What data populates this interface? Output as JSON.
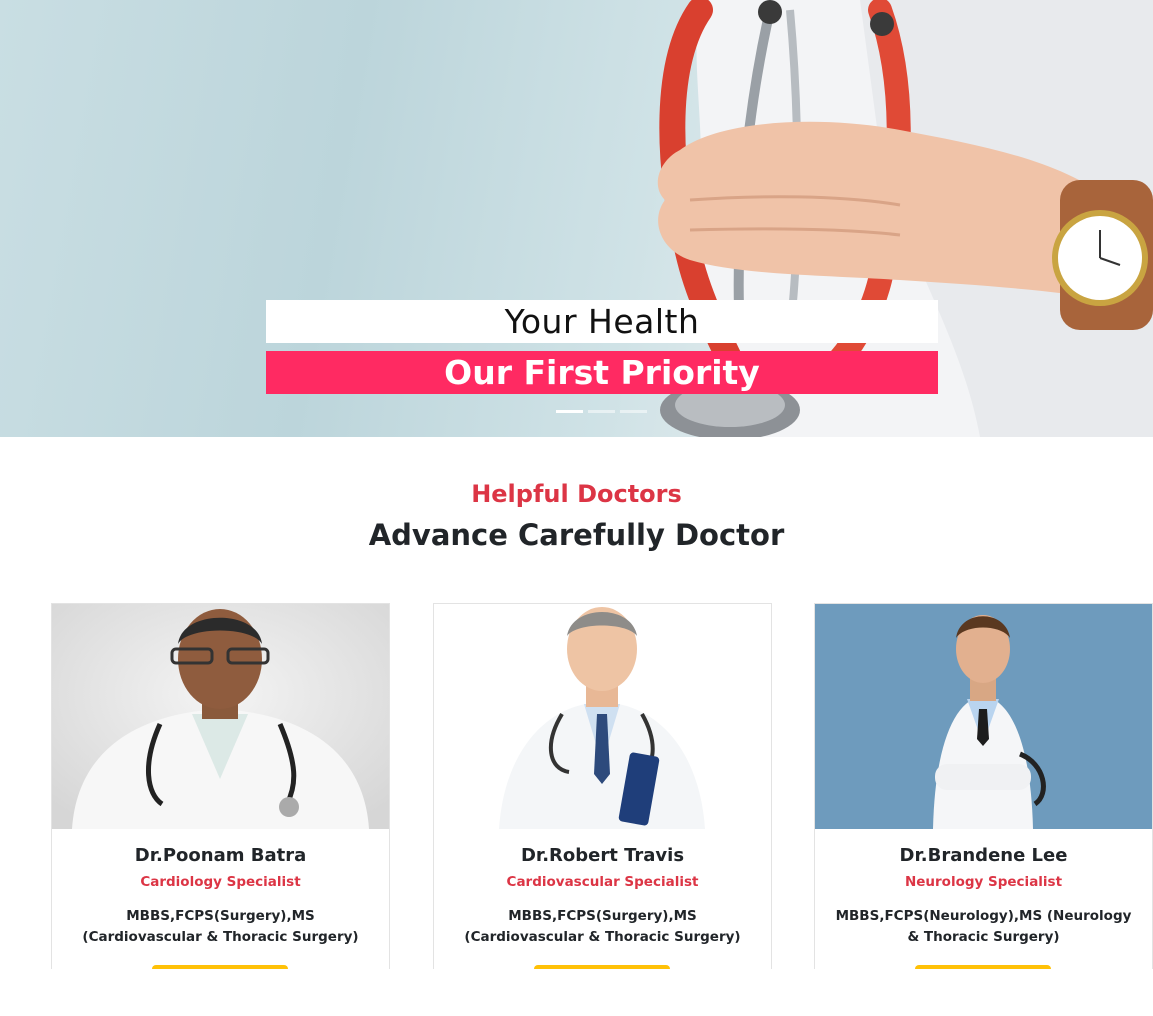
{
  "hero": {
    "title": "Your Health",
    "subtitle": "Our First Priority",
    "slides": 3,
    "active_slide": 1
  },
  "section": {
    "kicker": "Helpful Doctors",
    "title": "Advance Carefully Doctor"
  },
  "doctors": [
    {
      "name": "Dr.Poonam Batra",
      "specialty": "Cardiology Specialist",
      "qualifications": "MBBS,FCPS(Surgery),MS (Cardiovascular & Thoracic Surgery)"
    },
    {
      "name": "Dr.Robert Travis",
      "specialty": "Cardiovascular Specialist",
      "qualifications": "MBBS,FCPS(Surgery),MS (Cardiovascular & Thoracic Surgery)"
    },
    {
      "name": "Dr.Brandene Lee",
      "specialty": "Neurology Specialist",
      "qualifications": "MBBS,FCPS(Neurology),MS (Neurology & Thoracic Surgery)"
    }
  ],
  "colors": {
    "accent_red": "#dc3545",
    "hero_pink": "#ff2a62",
    "button_yellow": "#ffc107"
  }
}
